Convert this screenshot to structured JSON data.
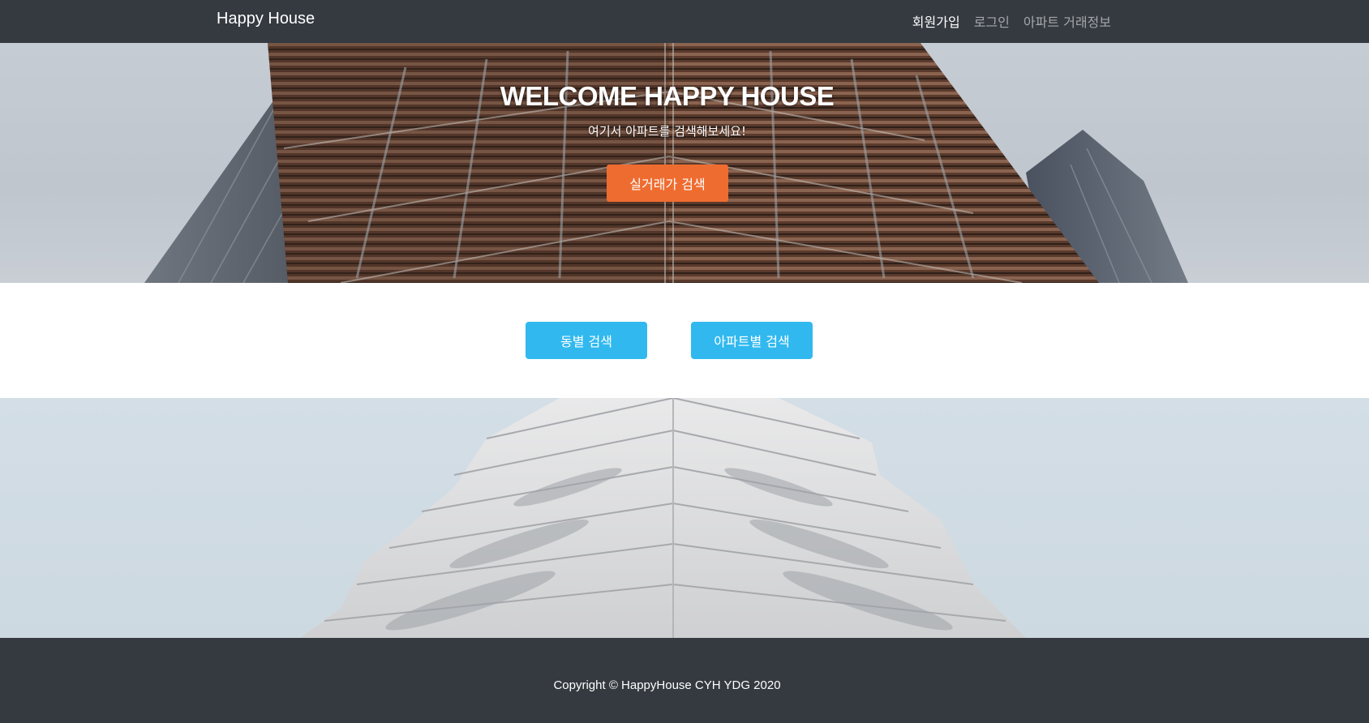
{
  "nav": {
    "brand": "Happy House",
    "links": [
      {
        "label": "회원가입",
        "active": true
      },
      {
        "label": "로그인",
        "active": false
      },
      {
        "label": "아파트 거래정보",
        "active": false
      }
    ]
  },
  "hero": {
    "title": "WELCOME HAPPY HOUSE",
    "subtitle": "여기서 아파트를 검색해보세요!",
    "button_label": "실거래가 검색"
  },
  "search_buttons": {
    "dong_label": "동별 검색",
    "apt_label": "아파트별 검색"
  },
  "footer": {
    "copyright": "Copyright © HappyHouse CYH YDG 2020"
  },
  "colors": {
    "navbar": "#343a40",
    "accent_orange": "#ef6c30",
    "accent_blue": "#31b9ef"
  }
}
